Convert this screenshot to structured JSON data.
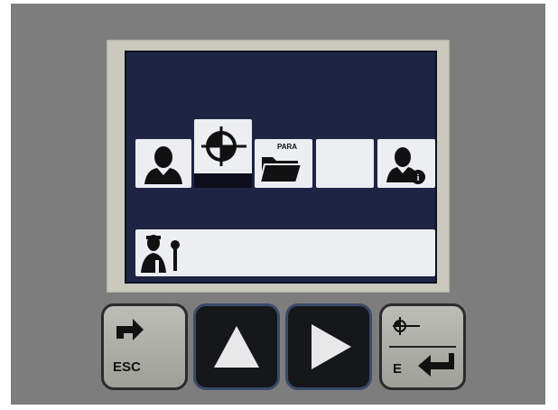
{
  "screen": {
    "menu_tiles": [
      {
        "name": "user",
        "icon": "user-icon"
      },
      {
        "name": "reference-point",
        "icon": "crosshair-icon",
        "selected": true
      },
      {
        "name": "parameters",
        "icon": "folder-icon",
        "label": "PARA"
      },
      {
        "name": "empty",
        "icon": ""
      },
      {
        "name": "user-info",
        "icon": "user-info-icon"
      }
    ],
    "service_tile": {
      "icon": "service-technician-icon"
    }
  },
  "keys": {
    "esc_label": "ESC",
    "enter_label": "E"
  },
  "colors": {
    "lcd_background": "#1e2443",
    "tile_background": "#eceef2",
    "housing": "#7d7d7d",
    "bezel": "#c9cabd"
  }
}
